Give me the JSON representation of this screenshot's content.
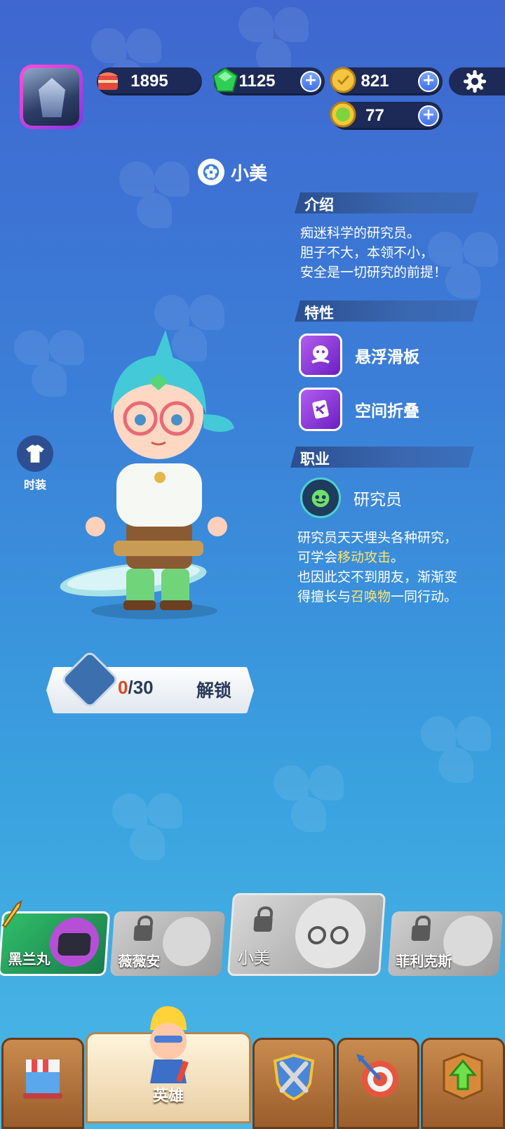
{
  "resources": {
    "cake": "1895",
    "gems": "1125",
    "coins": "821",
    "tokens": "77"
  },
  "hero": {
    "name": "小美"
  },
  "intro": {
    "title": "介绍",
    "lines": [
      "痴迷科学的研究员。",
      "胆子不大，本领不小，",
      "安全是一切研究的前提！"
    ]
  },
  "traits": {
    "title": "特性",
    "items": [
      {
        "label": "悬浮滑板",
        "icon": "hoverboard-icon"
      },
      {
        "label": "空间折叠",
        "icon": "space-fold-icon"
      }
    ]
  },
  "profession": {
    "title": "职业",
    "name": "研究员",
    "desc1": "研究员天天埋头各种研究，",
    "desc2_pre": "可学会",
    "desc2_hl": "移动攻击",
    "desc2_post": "。",
    "desc3": "也因此交不到朋友，渐渐变",
    "desc4_pre": "得擅长与",
    "desc4_hl": "召唤物",
    "desc4_post": "一同行动。"
  },
  "fashion_label": "时装",
  "unlock": {
    "current": "0",
    "total": "/30",
    "button": "解锁"
  },
  "hero_cards": [
    {
      "name": "黑兰丸",
      "locked": false
    },
    {
      "name": "薇薇安",
      "locked": true
    },
    {
      "name": "小美",
      "locked": true
    },
    {
      "name": "菲利克斯",
      "locked": true
    }
  ],
  "nav": {
    "active_label": "英雄"
  },
  "colors": {
    "highlight": "#ffe36b",
    "unlock_current": "#e0481f"
  }
}
